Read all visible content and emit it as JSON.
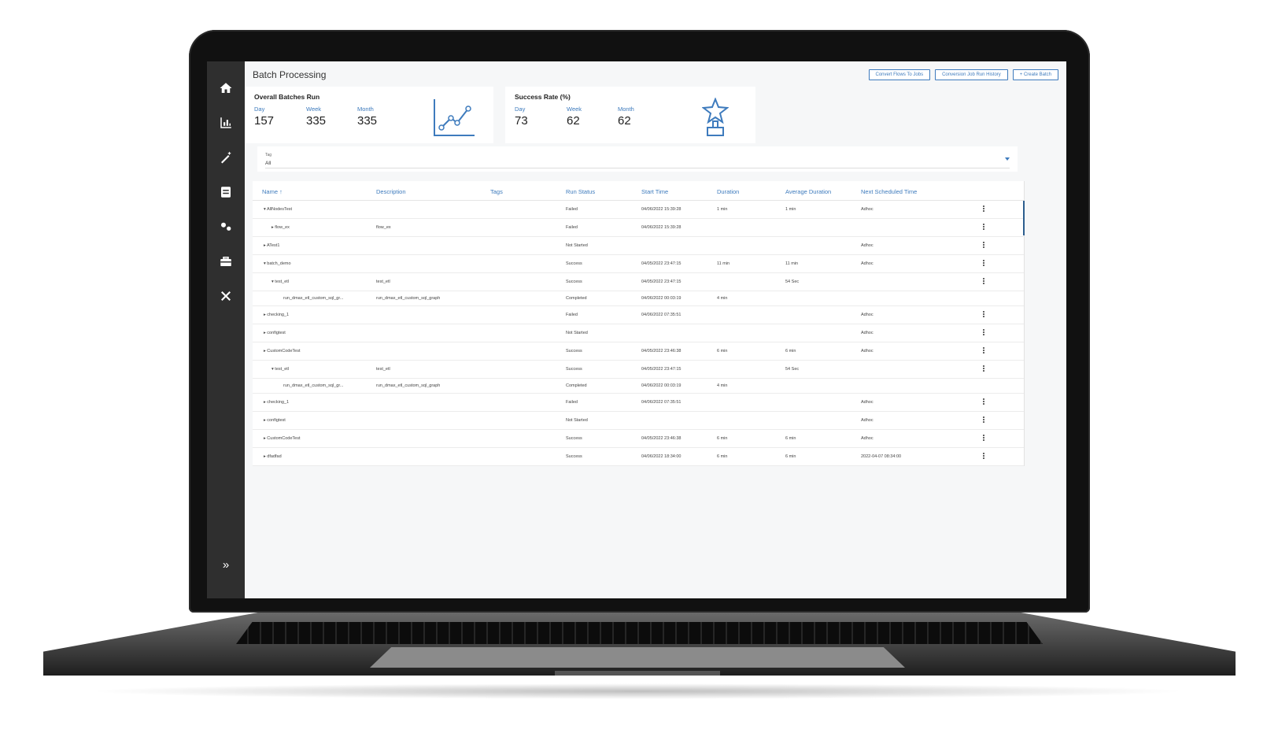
{
  "sidebar": {
    "items": [
      {
        "icon": "home-icon"
      },
      {
        "icon": "bar-chart-icon"
      },
      {
        "icon": "magic-wand-icon"
      },
      {
        "icon": "storage-icon"
      },
      {
        "icon": "connections-icon"
      },
      {
        "icon": "toolbox-icon"
      },
      {
        "icon": "tools-icon"
      }
    ],
    "expand_glyph": "»"
  },
  "header": {
    "title": "Batch Processing",
    "buttons": [
      "Convert Flows To Jobs",
      "Conversion Job Run History",
      "+ Create Batch"
    ]
  },
  "cards": {
    "batches": {
      "title": "Overall Batches Run",
      "stats": [
        {
          "label": "Day",
          "value": "157"
        },
        {
          "label": "Week",
          "value": "335"
        },
        {
          "label": "Month",
          "value": "335"
        }
      ],
      "icon": "line-chart-icon"
    },
    "success": {
      "title": "Success Rate (%)",
      "stats": [
        {
          "label": "Day",
          "value": "73"
        },
        {
          "label": "Week",
          "value": "62"
        },
        {
          "label": "Month",
          "value": "62"
        }
      ],
      "icon": "trophy-star-icon"
    }
  },
  "filter": {
    "label": "Tag",
    "value": "All"
  },
  "table": {
    "columns": [
      "Name",
      "Description",
      "Tags",
      "Run Status",
      "Start Time",
      "Duration",
      "Average Duration",
      "Next Scheduled Time"
    ],
    "sort_glyph": "↑",
    "rows": [
      {
        "name": "▾ AllNodesTest",
        "indent": 0,
        "description": "",
        "tags": "",
        "status": "Failed",
        "start": "04/06/2022 15:39:28",
        "duration": "1 min",
        "avg": "1 min",
        "next": "Adhoc",
        "menu": true
      },
      {
        "name": "▸ flow_ex",
        "indent": 1,
        "description": "flow_ex",
        "tags": "",
        "status": "Failed",
        "start": "04/06/2022 15:39:28",
        "duration": "",
        "avg": "",
        "next": "",
        "menu": true
      },
      {
        "name": "▸ ATest1",
        "indent": 0,
        "description": "",
        "tags": "",
        "status": "Not Started",
        "start": "",
        "duration": "",
        "avg": "",
        "next": "Adhoc",
        "menu": true
      },
      {
        "name": "▾ batch_demo",
        "indent": 0,
        "description": "",
        "tags": "",
        "status": "Success",
        "start": "04/05/2022 23:47:15",
        "duration": "11 min",
        "avg": "11 min",
        "next": "Adhoc",
        "menu": true
      },
      {
        "name": "▾ test_etl",
        "indent": 1,
        "description": "test_etl",
        "tags": "",
        "status": "Success",
        "start": "04/05/2022 23:47:15",
        "duration": "",
        "avg": "54 Sec",
        "next": "",
        "menu": true
      },
      {
        "name": "run_dmax_etl_custom_sql_gr...",
        "indent": 2,
        "description": "run_dmax_etl_custom_sql_graph",
        "tags": "",
        "status": "Completed",
        "start": "04/06/2022 00:03:19",
        "duration": "4 min",
        "avg": "",
        "next": "",
        "menu": false
      },
      {
        "name": "▸ checking_1",
        "indent": 0,
        "description": "",
        "tags": "",
        "status": "Failed",
        "start": "04/06/2022 07:35:51",
        "duration": "",
        "avg": "",
        "next": "Adhoc",
        "menu": true
      },
      {
        "name": "▸ configtest",
        "indent": 0,
        "description": "",
        "tags": "",
        "status": "Not Started",
        "start": "",
        "duration": "",
        "avg": "",
        "next": "Adhoc",
        "menu": true
      },
      {
        "name": "▸ CustomCodeTest",
        "indent": 0,
        "description": "",
        "tags": "",
        "status": "Success",
        "start": "04/05/2022 23:46:38",
        "duration": "6 min",
        "avg": "6 min",
        "next": "Adhoc",
        "menu": true
      },
      {
        "name": "▾ test_etl",
        "indent": 1,
        "description": "test_etl",
        "tags": "",
        "status": "Success",
        "start": "04/05/2022 23:47:15",
        "duration": "",
        "avg": "54 Sec",
        "next": "",
        "menu": true
      },
      {
        "name": "run_dmax_etl_custom_sql_gr...",
        "indent": 2,
        "description": "run_dmax_etl_custom_sql_graph",
        "tags": "",
        "status": "Completed",
        "start": "04/06/2022 00:03:19",
        "duration": "4 min",
        "avg": "",
        "next": "",
        "menu": false
      },
      {
        "name": "▸ checking_1",
        "indent": 0,
        "description": "",
        "tags": "",
        "status": "Failed",
        "start": "04/06/2022 07:35:51",
        "duration": "",
        "avg": "",
        "next": "Adhoc",
        "menu": true
      },
      {
        "name": "▸ configtest",
        "indent": 0,
        "description": "",
        "tags": "",
        "status": "Not Started",
        "start": "",
        "duration": "",
        "avg": "",
        "next": "Adhoc",
        "menu": true
      },
      {
        "name": "▸ CustomCodeTest",
        "indent": 0,
        "description": "",
        "tags": "",
        "status": "Success",
        "start": "04/05/2022 23:46:38",
        "duration": "6 min",
        "avg": "6 min",
        "next": "Adhoc",
        "menu": true
      },
      {
        "name": "▸ dfadfad",
        "indent": 0,
        "description": "",
        "tags": "",
        "status": "Success",
        "start": "04/06/2022 18:34:00",
        "duration": "6 min",
        "avg": "6 min",
        "next": "2022-04-07 08:34:00",
        "menu": true
      }
    ]
  }
}
